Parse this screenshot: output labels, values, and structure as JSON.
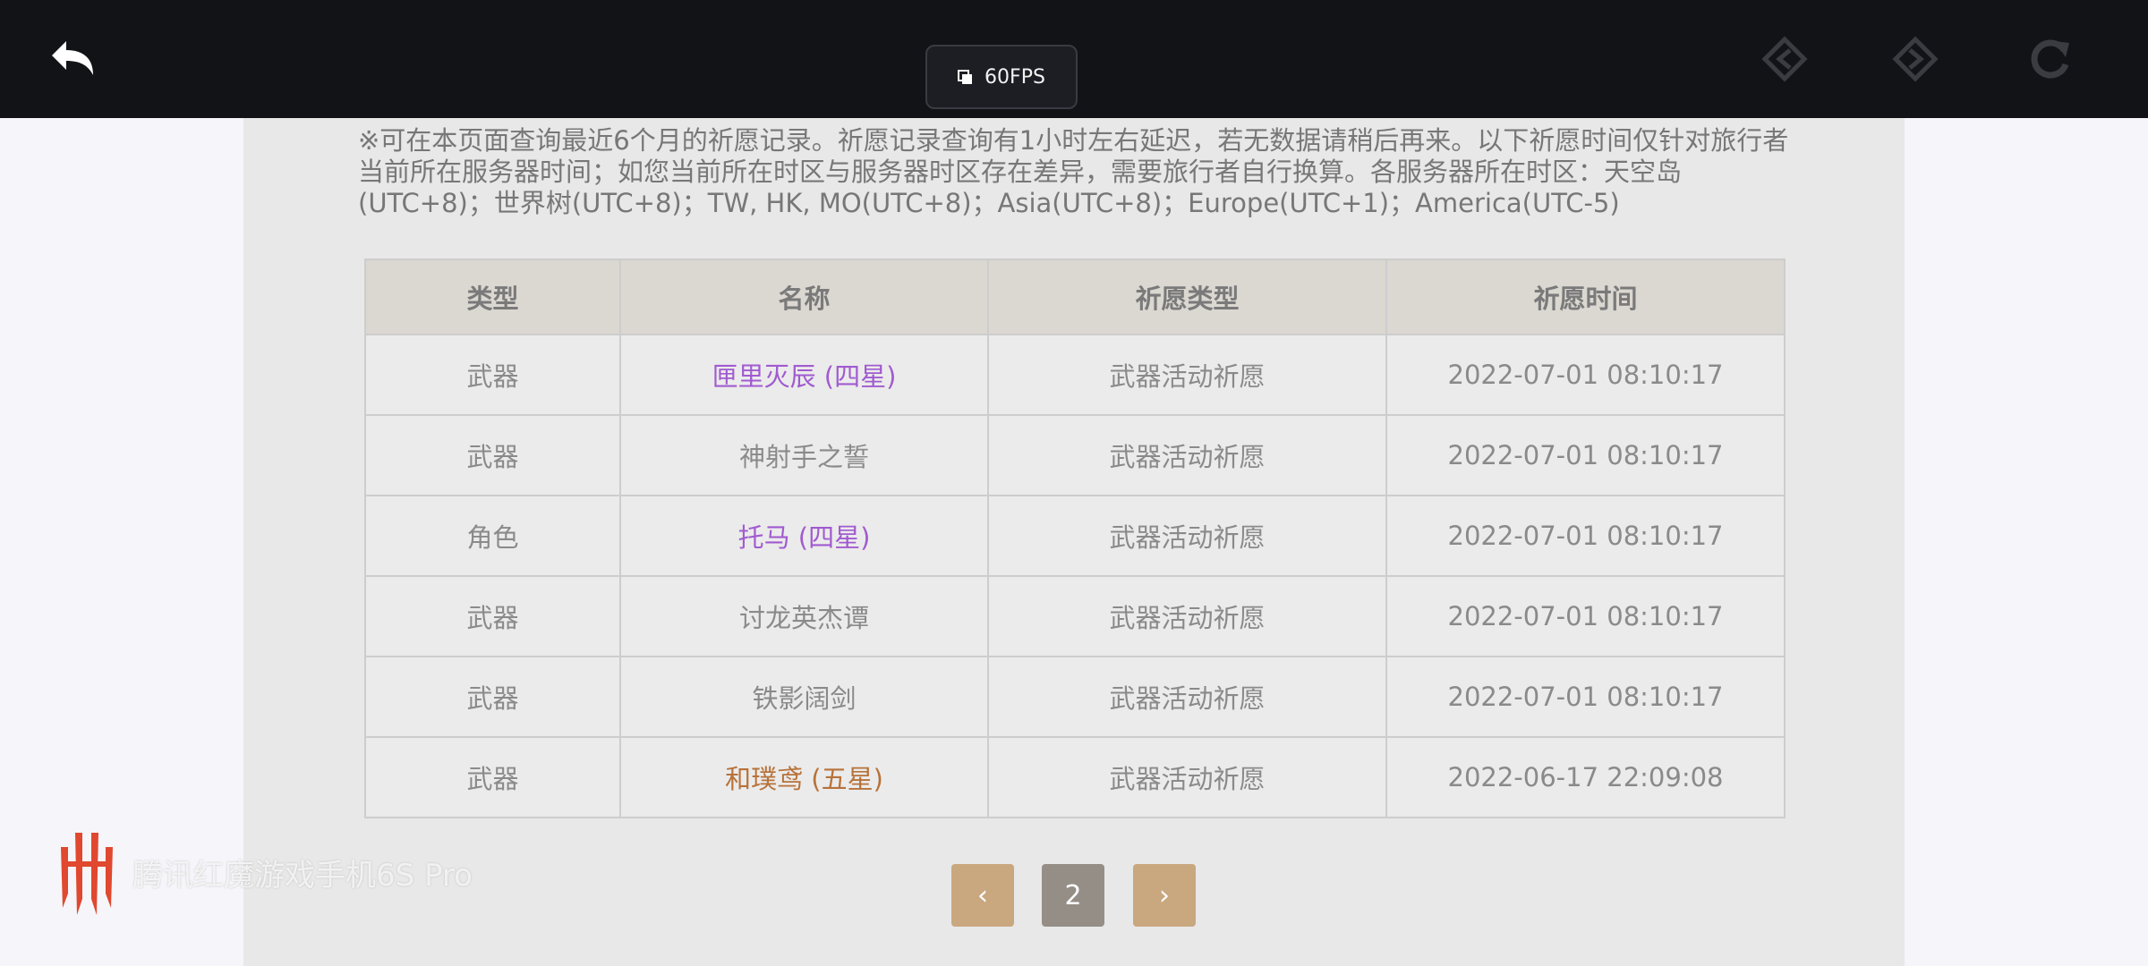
{
  "topbar": {
    "fps_label": "60FPS",
    "icons": [
      "back-icon",
      "prev-page-icon",
      "next-page-icon",
      "refresh-icon"
    ]
  },
  "notice": {
    "text": "※可在本页面查询最近6个月的祈愿记录。祈愿记录查询有1小时左右延迟，若无数据请稍后再来。以下祈愿时间仅针对旅行者当前所在服务器时间；如您当前所在时区与服务器时区存在差异，需要旅行者自行换算。各服务器所在时区：天空岛(UTC+8)；世界树(UTC+8)；TW, HK, MO(UTC+8)；Asia(UTC+8)；Europe(UTC+1)；America(UTC-5)"
  },
  "table": {
    "headers": [
      "类型",
      "名称",
      "祈愿类型",
      "祈愿时间"
    ],
    "rows": [
      {
        "type": "武器",
        "name": "匣里灭辰 (四星)",
        "quality": "q4",
        "wish_type": "武器活动祈愿",
        "time": "2022-07-01 08:10:17"
      },
      {
        "type": "武器",
        "name": "神射手之誓",
        "quality": "q3",
        "wish_type": "武器活动祈愿",
        "time": "2022-07-01 08:10:17"
      },
      {
        "type": "角色",
        "name": "托马 (四星)",
        "quality": "q4",
        "wish_type": "武器活动祈愿",
        "time": "2022-07-01 08:10:17"
      },
      {
        "type": "武器",
        "name": "讨龙英杰谭",
        "quality": "q3",
        "wish_type": "武器活动祈愿",
        "time": "2022-07-01 08:10:17"
      },
      {
        "type": "武器",
        "name": "铁影阔剑",
        "quality": "q3",
        "wish_type": "武器活动祈愿",
        "time": "2022-07-01 08:10:17"
      },
      {
        "type": "武器",
        "name": "和璞鸢 (五星)",
        "quality": "q5",
        "wish_type": "武器活动祈愿",
        "time": "2022-06-17 22:09:08"
      }
    ],
    "quality_colors": {
      "q3": "#8a8a8a",
      "q4": "#a15bd0",
      "q5": "#b7723a"
    }
  },
  "pagination": {
    "prev_glyph": "‹",
    "current_page": "2",
    "next_glyph": "›",
    "colors": {
      "arrow_bg": "#c9a77f",
      "current_bg": "#958e87"
    }
  },
  "watermark": {
    "text": "腾讯红魔游戏手机6S Pro",
    "logo_color": "#e0482f"
  }
}
